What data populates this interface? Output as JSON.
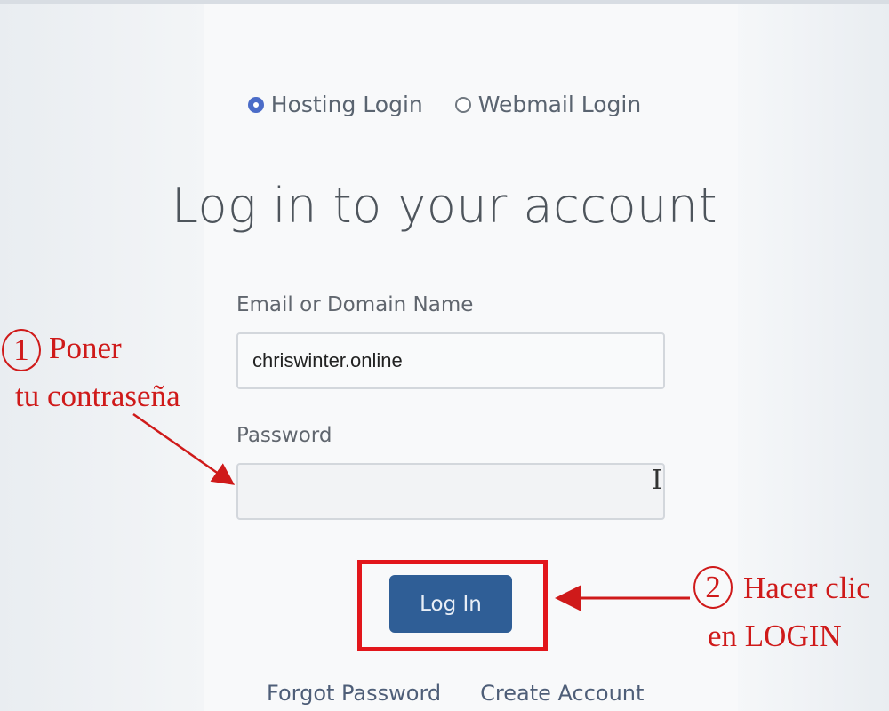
{
  "login_type": {
    "options": [
      {
        "label": "Hosting Login",
        "selected": true
      },
      {
        "label": "Webmail Login",
        "selected": false
      }
    ]
  },
  "title": "Log in to your account",
  "form": {
    "email_label": "Email or Domain Name",
    "email_value": "chriswinter.online",
    "password_label": "Password",
    "password_value": "",
    "login_button": "Log In"
  },
  "links": {
    "forgot": "Forgot Password",
    "create": "Create Account"
  },
  "annotations": {
    "step1_number": "1",
    "step1_line1": "Poner",
    "step1_line2": "tu contraseña",
    "step2_number": "2",
    "step2_line1": "Hacer clic",
    "step2_line2": "en LOGIN"
  },
  "colors": {
    "accent": "#4b6cc8",
    "button": "#2f5e96",
    "annotation_red": "#e2161b"
  }
}
